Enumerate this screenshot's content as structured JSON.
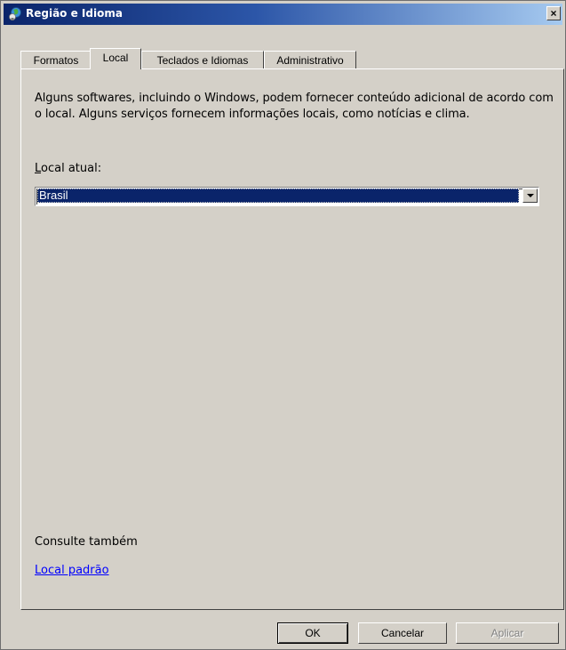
{
  "window": {
    "title": "Região e Idioma",
    "close_label": "×"
  },
  "tabs": [
    {
      "label": "Formatos"
    },
    {
      "label": "Local"
    },
    {
      "label": "Teclados e Idiomas"
    },
    {
      "label": "Administrativo"
    }
  ],
  "active_tab": "Local",
  "panel": {
    "description": "Alguns softwares, incluindo o Windows, podem fornecer conteúdo adicional de acordo com o local. Alguns serviços fornecem informações locais, como notícias e clima.",
    "current_location_label_prefix": "",
    "current_location_label_mnemonic": "L",
    "current_location_label_rest": "ocal atual:",
    "current_location_value": "Brasil",
    "see_also_label": "Consulte também",
    "default_location_link": "Local padrão"
  },
  "buttons": {
    "ok": "OK",
    "cancel": "Cancelar",
    "apply": "Aplicar"
  },
  "colors": {
    "titlebar_start": "#0a246a",
    "titlebar_end": "#a6caf0",
    "selection": "#0a246a",
    "link": "#0000ff",
    "face": "#d4d0c8"
  },
  "icons": {
    "title_icon": "globe-region-icon",
    "dropdown_arrow": "chevron-down-icon"
  }
}
